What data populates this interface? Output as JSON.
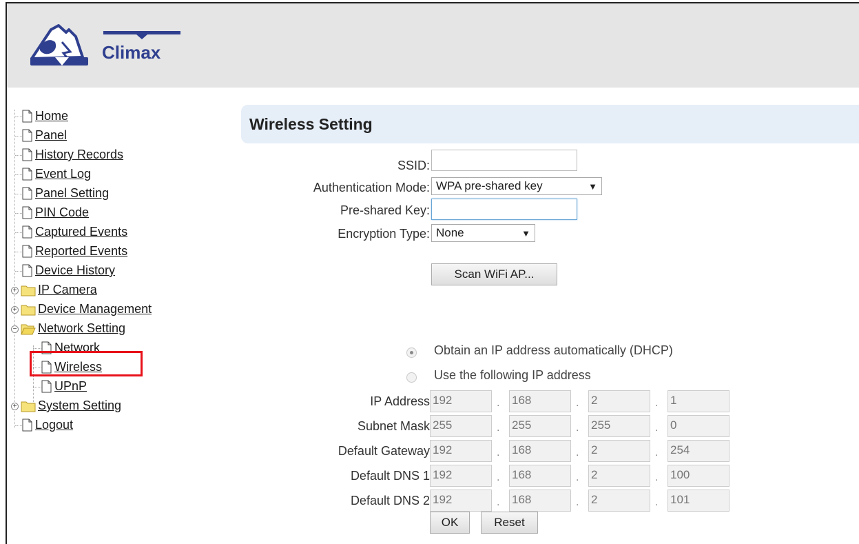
{
  "logo": {
    "text": "Climax"
  },
  "menu": {
    "items": [
      {
        "label": "Home"
      },
      {
        "label": "Panel"
      },
      {
        "label": "History Records"
      },
      {
        "label": "Event Log"
      },
      {
        "label": "Panel Setting"
      },
      {
        "label": "PIN Code"
      },
      {
        "label": "Captured Events"
      },
      {
        "label": "Reported Events"
      },
      {
        "label": "Device History"
      },
      {
        "label": "IP Camera"
      },
      {
        "label": "Device Management"
      },
      {
        "label": "Network Setting"
      },
      {
        "label": "Network"
      },
      {
        "label": "Wireless"
      },
      {
        "label": "UPnP"
      },
      {
        "label": "System Setting"
      },
      {
        "label": "Logout"
      }
    ],
    "highlight_color": "#e8121a"
  },
  "page": {
    "title": "Wireless Setting"
  },
  "form": {
    "ssid_label": "SSID:",
    "ssid_value": "",
    "auth_label": "Authentication Mode:",
    "auth_value": "WPA pre-shared key",
    "psk_label": "Pre-shared Key:",
    "psk_value": "",
    "enc_label": "Encryption Type:",
    "enc_value": "None",
    "scan_button": "Scan WiFi AP...",
    "dhcp_label": "Obtain an IP address automatically (DHCP)",
    "static_label": "Use the following IP address",
    "ip_rows": [
      {
        "label": "IP Address",
        "octets": [
          "192",
          "168",
          "2",
          "1"
        ]
      },
      {
        "label": "Subnet Mask",
        "octets": [
          "255",
          "255",
          "255",
          "0"
        ]
      },
      {
        "label": "Default Gateway",
        "octets": [
          "192",
          "168",
          "2",
          "254"
        ]
      },
      {
        "label": "Default DNS 1",
        "octets": [
          "192",
          "168",
          "2",
          "100"
        ]
      },
      {
        "label": "Default DNS 2",
        "octets": [
          "192",
          "168",
          "2",
          "101"
        ]
      }
    ],
    "ok_button": "OK",
    "reset_button": "Reset"
  }
}
